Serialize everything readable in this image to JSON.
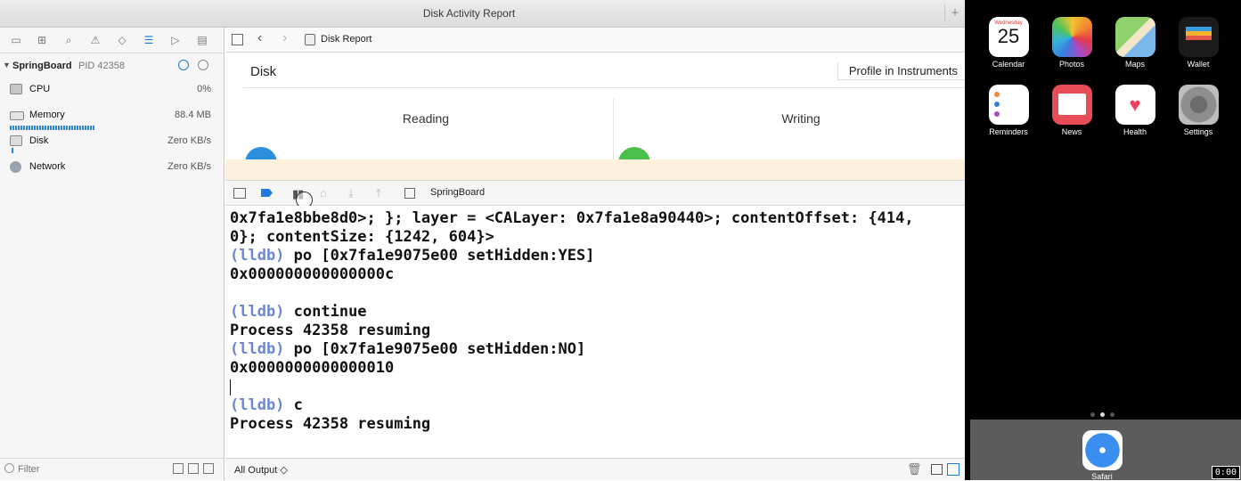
{
  "window": {
    "title": "Disk Activity Report"
  },
  "navigator": {
    "process": {
      "name": "SpringBoard",
      "pid": "PID 42358"
    },
    "gauges": [
      {
        "label": "CPU",
        "value": "0%"
      },
      {
        "label": "Memory",
        "value": "88.4 MB"
      },
      {
        "label": "Disk",
        "value": "Zero KB/s"
      },
      {
        "label": "Network",
        "value": "Zero KB/s"
      }
    ],
    "filter_placeholder": "Filter"
  },
  "jumpbar": {
    "title": "Disk Report"
  },
  "report": {
    "heading": "Disk",
    "profile_button": "Profile in Instruments",
    "columns": [
      "Reading",
      "Writing"
    ],
    "colors": {
      "reading": "#2b8fe0",
      "writing": "#4cbf4c"
    }
  },
  "debug": {
    "process_label": "SpringBoard"
  },
  "console": {
    "lines": [
      {
        "prompt": "",
        "text": "0x7fa1e8bbe8d0>; }; layer = <CALayer: 0x7fa1e8a90440>; contentOffset: {414,"
      },
      {
        "prompt": "",
        "text": "0}; contentSize: {1242, 604}>"
      },
      {
        "prompt": "(lldb)",
        "text": " po [0x7fa1e9075e00 setHidden:YES]"
      },
      {
        "prompt": "",
        "text": "0x000000000000000c"
      },
      {
        "prompt": "",
        "text": ""
      },
      {
        "prompt": "(lldb)",
        "text": " continue"
      },
      {
        "prompt": "",
        "text": "Process 42358 resuming"
      },
      {
        "prompt": "(lldb)",
        "text": " po [0x7fa1e9075e00 setHidden:NO]"
      },
      {
        "prompt": "",
        "text": "0x0000000000000010"
      },
      {
        "prompt": "",
        "text": ""
      },
      {
        "prompt": "",
        "text": ""
      },
      {
        "prompt": "(lldb)",
        "text": " c"
      },
      {
        "prompt": "",
        "text": "Process 42358 resuming"
      }
    ]
  },
  "output_selector": "All Output ◇",
  "simulator": {
    "apps": [
      {
        "name": "Calendar",
        "day": "Wednesday",
        "date": "25"
      },
      {
        "name": "Photos"
      },
      {
        "name": "Maps"
      },
      {
        "name": "Wallet"
      },
      {
        "name": "Reminders"
      },
      {
        "name": "News"
      },
      {
        "name": "Health"
      },
      {
        "name": "Settings"
      }
    ],
    "dock_app": "Safari",
    "timer": "0:00"
  }
}
